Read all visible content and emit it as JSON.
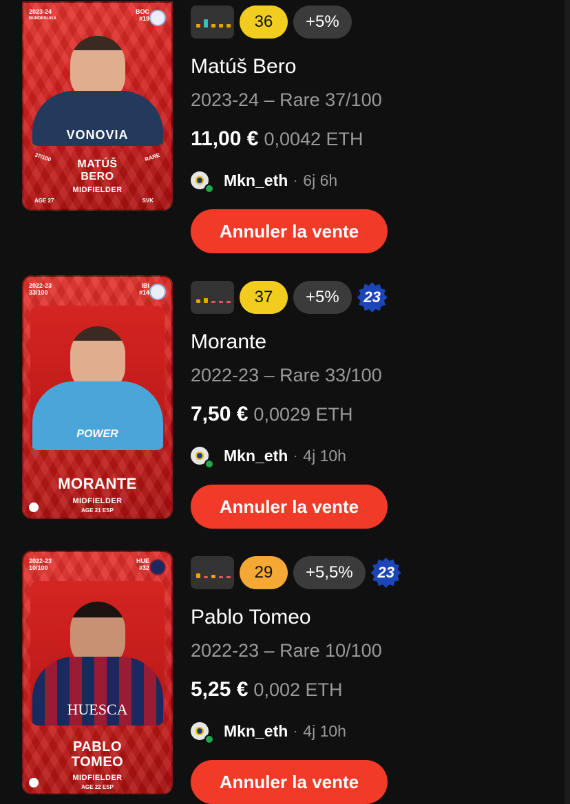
{
  "listings": [
    {
      "card": {
        "season": "2023-24",
        "league": "BUNDESLIGA",
        "club_code": "BOC",
        "shirt_number": "#19",
        "serial": "37/100",
        "rarity_tag": "RARE",
        "first_name": "MATÚŠ",
        "last_name": "BERO",
        "position": "MIDFIELDER",
        "age": "AGE 27",
        "country": "SVK",
        "sponsor": "VONOVIA"
      },
      "form_colors": [
        "#e9a400",
        "#2ec4b6",
        "#e9a400",
        "#e9a400",
        "#e9a400"
      ],
      "score": "36",
      "score_color": "#f2cd1f",
      "bonus": "+5%",
      "season_badge": "",
      "player_name": "Matúš Bero",
      "meta": "2023-24 – Rare 37/100",
      "price_eur": "11,00 €",
      "price_eth": "0,0042 ETH",
      "seller": "Mkn_eth",
      "separator": "·",
      "time_left": "6j 6h",
      "cancel_label": "Annuler la vente"
    },
    {
      "card": {
        "season": "2022-23",
        "serial": "33/100",
        "club_code": "IBI",
        "shirt_number": "#14",
        "last_name": "MORANTE",
        "position": "MIDFIELDER",
        "age": "AGE 21",
        "country": "ESP",
        "sponsor": "POWER"
      },
      "form_colors": [
        "#e9a400",
        "#e9a400",
        "#e05a5a",
        "#e05a5a",
        "#e05a5a"
      ],
      "score": "37",
      "score_color": "#f2cd1f",
      "bonus": "+5%",
      "season_badge": "23",
      "player_name": "Morante",
      "meta": "2022-23 – Rare 33/100",
      "price_eur": "7,50 €",
      "price_eth": "0,0029 ETH",
      "seller": "Mkn_eth",
      "separator": "·",
      "time_left": "4j 10h",
      "cancel_label": "Annuler la vente"
    },
    {
      "card": {
        "season": "2022-23",
        "serial": "10/100",
        "club_code": "HUE",
        "shirt_number": "#32",
        "first_name": "PABLO",
        "last_name": "TOMEO",
        "position": "MIDFIELDER",
        "age": "AGE 22",
        "country": "ESP",
        "sponsor": "HUESCA"
      },
      "form_colors": [
        "#e9a400",
        "#e05a5a",
        "#e9a400",
        "#e05a5a",
        "#e05a5a"
      ],
      "score": "29",
      "score_color": "#f6a834",
      "bonus": "+5,5%",
      "season_badge": "23",
      "player_name": "Pablo Tomeo",
      "meta": "2022-23 – Rare 10/100",
      "price_eur": "5,25 €",
      "price_eth": "0,002 ETH",
      "seller": "Mkn_eth",
      "separator": "·",
      "time_left": "4j 10h",
      "cancel_label": "Annuler la vente"
    }
  ]
}
